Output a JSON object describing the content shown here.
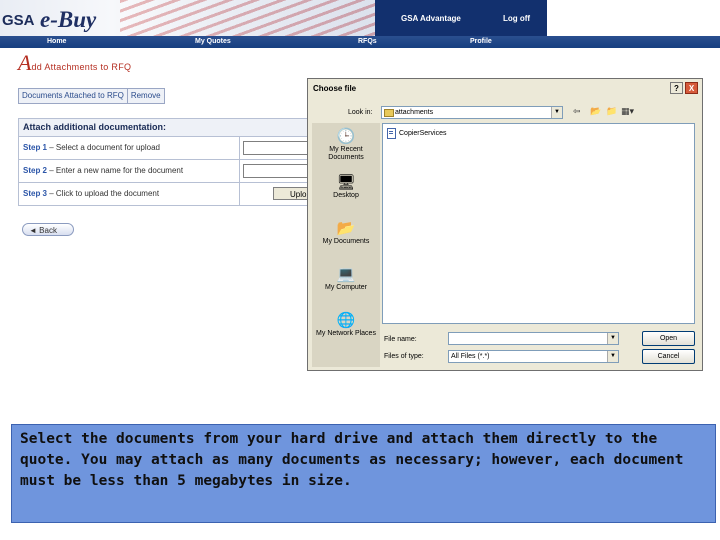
{
  "banner": {
    "logo_gsa": "GSA",
    "logo_ebuy": "e-Buy",
    "top_links": [
      "GSA Advantage",
      "Log off"
    ],
    "nav": [
      "Home",
      "My Quotes",
      "RFQs",
      "Profile"
    ]
  },
  "page": {
    "title_initial": "A",
    "title_rest": "dd Attachments to RFQ",
    "tabs": [
      "Documents Attached to RFQ",
      "Remove"
    ],
    "form": {
      "heading": "Attach additional documentation:",
      "steps": [
        {
          "step": "Step 1",
          "text": " – Select a document for upload"
        },
        {
          "step": "Step 2",
          "text": " – Enter a new name for the document"
        },
        {
          "step": "Step 3",
          "text": " – Click to upload the document"
        }
      ],
      "upload_label": "Uplo"
    },
    "back_label": "Back"
  },
  "dialog": {
    "title": "Choose file",
    "help": "?",
    "close": "X",
    "look_in_label": "Look in:",
    "look_in_value": "attachments",
    "places": [
      "My Recent Documents",
      "Desktop",
      "My Documents",
      "My Computer",
      "My Network Places"
    ],
    "files": [
      "CopierServices"
    ],
    "file_name_label": "File name:",
    "file_name_value": "",
    "file_type_label": "Files of type:",
    "file_type_value": "All Files (*.*)",
    "open_label": "Open",
    "cancel_label": "Cancel"
  },
  "caption": "Select the documents from your hard drive and attach them directly to the quote.  You may attach as many documents as necessary; however, each document must be less than 5 megabytes in size."
}
